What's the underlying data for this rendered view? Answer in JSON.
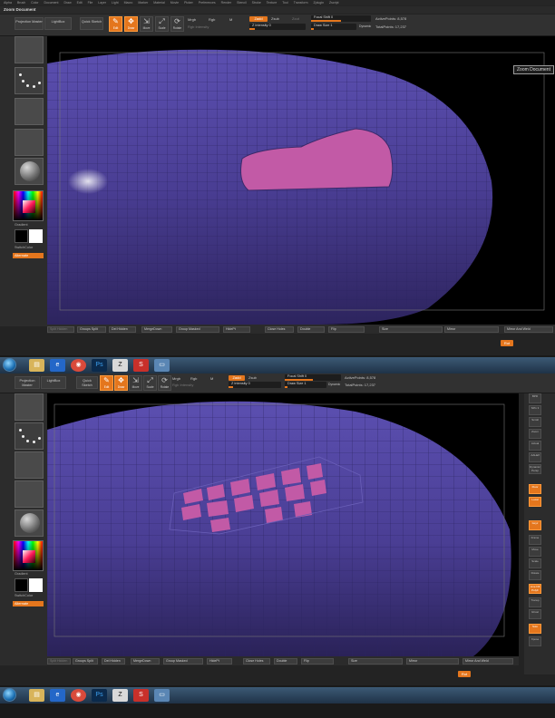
{
  "top": {
    "menu": [
      "Alpha",
      "Brush",
      "Color",
      "Document",
      "Draw",
      "Edit",
      "File",
      "Layer",
      "Light",
      "Macro",
      "Marker",
      "Material",
      "Movie",
      "Picker",
      "Preferences",
      "Render",
      "Stencil",
      "Stroke",
      "Texture",
      "Tool",
      "Transform",
      "Zplugin",
      "Zscript"
    ],
    "title": "Zoom Document",
    "toolbar": {
      "projection_master": "Projection Master",
      "lightbox": "LightBox",
      "quick_sketch": "Quick Sketch",
      "edit": "Edit",
      "draw": "Draw",
      "move": "Move",
      "scale": "Scale",
      "rotate": "Rotate",
      "mrgb": "Mrgb",
      "rgb": "Rgb",
      "m": "M",
      "rgb_intensity": "Rgb Intensity",
      "zadd": "Zadd",
      "zsub": "Zsub",
      "zcut": "Zcut",
      "z_intensity": "Z Intensity 0",
      "focal_shift": "Focal Shift 0",
      "draw_size": "Draw Size 1",
      "dynamic": "Dynamic",
      "active_points": "ActivePoints: 8,578",
      "total_points": "TotalPoints: 17,237"
    },
    "left": {
      "gradient": "Gradient",
      "switch_color": "SwitchColor",
      "alternate": "Alternate"
    },
    "tooltip": "Zoom Document",
    "bottom": {
      "split_hidden": "Split Hidden",
      "groups_split": "Groups Split",
      "del_hidden": "Del Hidden",
      "merge_down": "MergeDown",
      "group_masked": "Group Masked",
      "hide_pt": "HidePt",
      "close_holes": "Close Holes",
      "double": "Double",
      "flip": "Flip",
      "size": "Size",
      "mirror": "Mirror",
      "mirror_and_weld": "Mirror And Weld",
      "rot": "Rot"
    }
  },
  "bottom": {
    "menu": [
      "Alpha",
      "Brush",
      "Color",
      "Document",
      "Draw",
      "Edit",
      "File",
      "Layer",
      "Light",
      "Macro",
      "Marker",
      "Material",
      "Movie",
      "Picker",
      "Preferences",
      "Render",
      "Stencil",
      "Stroke",
      "Texture",
      "Tool",
      "Transform",
      "Zplugin",
      "Zscript"
    ],
    "toolbar": {
      "projection_master": "Projection Master",
      "lightbox": "LightBox",
      "quick_sketch": "Quick Sketch",
      "edit": "Edit",
      "draw": "Draw",
      "move": "Move",
      "scale": "Scale",
      "rotate": "Rotate",
      "mrgb": "Mrgb",
      "rgb": "Rgb",
      "m": "M",
      "rgb_intensity": "Rgb Intensity",
      "zadd": "Zadd",
      "zsub": "Zsub",
      "z_intensity": "Z Intensity 0",
      "focal_shift": "Focal Shift 0",
      "draw_size": "Draw Size 1",
      "dynamic": "Dynamic",
      "active_points": "ActivePoints: 8,578",
      "total_points": "TotalPoints: 17,237"
    },
    "left": {
      "gradient": "Gradient",
      "switch_color": "SwitchColor",
      "alternate": "Alternate"
    },
    "bottom": {
      "split_hidden": "Split Hidden",
      "groups_split": "Groups Split",
      "del_hidden": "Del Hidden",
      "merge_down": "MergeDown",
      "group_masked": "Group Masked",
      "hide_pt": "HidePt",
      "close_holes": "Close Holes",
      "double": "Double",
      "flip": "Flip",
      "size": "Size",
      "mirror": "Mirror",
      "mirror_and_weld": "Mirror And Weld",
      "rot": "Rot"
    },
    "right_shelf": [
      "BPR",
      "SPix 3",
      "Scroll",
      "Zoom",
      "Actual",
      "AAHalf",
      "Dynamic Persp",
      "Floor",
      "Local",
      "Gxyz",
      "Frame",
      "Move",
      "Scale",
      "Rotate",
      "Line Fill PolyF",
      "Transp",
      "Ghost",
      "Solo",
      "Xpose"
    ]
  },
  "colors": {
    "accent": "#e4761d",
    "mesh": "#4c3f92",
    "mask": "#c25aa6",
    "panel": "#2c2c2c"
  },
  "icons": [
    "start-orb-icon",
    "explorer-icon",
    "ie-icon",
    "chrome-icon",
    "photoshop-icon",
    "zbrush-icon",
    "sketchup-icon",
    "screen-icon"
  ]
}
